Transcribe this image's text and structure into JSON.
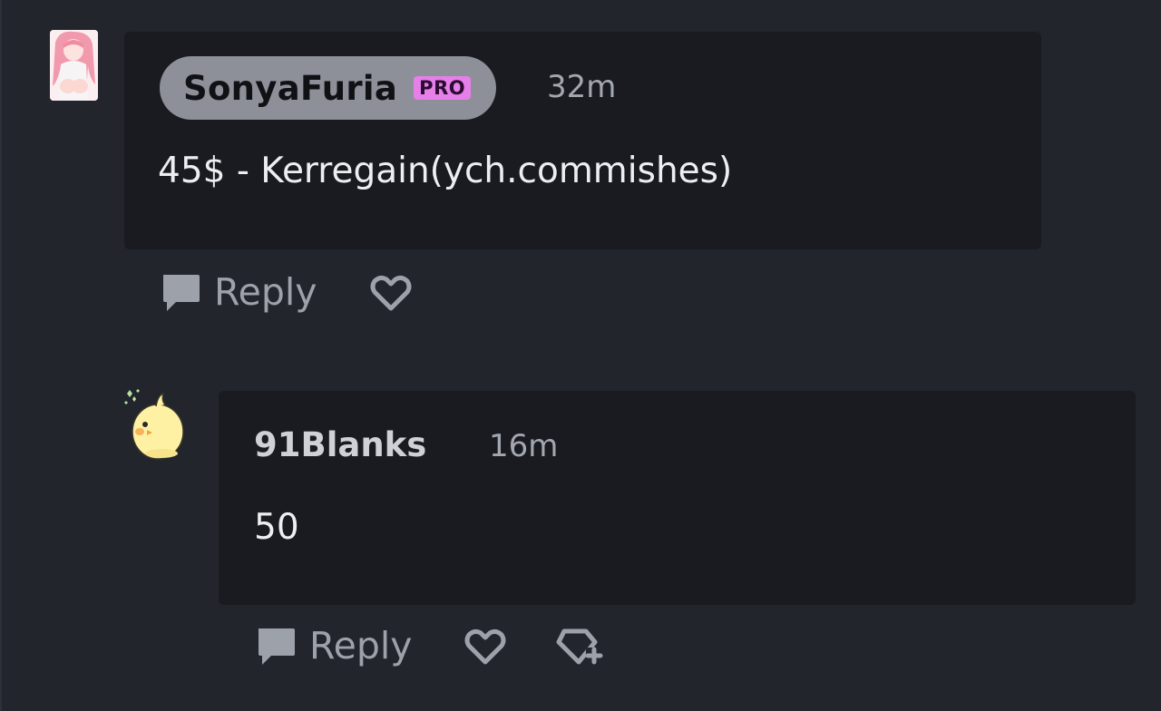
{
  "colors": {
    "page_background": "#22252b",
    "comment_background": "#191b20",
    "name_pill": "#8e9099",
    "pro_badge": "#e77fe8",
    "muted_text": "#9da1aa",
    "body_text": "#eceef2"
  },
  "comments": [
    {
      "username": "SonyaFuria",
      "badge": "PRO",
      "time": "32m",
      "body": "45$ - Kerregain(ych.commishes)",
      "actions": {
        "reply_label": "Reply",
        "icons": [
          "reply-bubble-icon",
          "heart-icon"
        ]
      }
    },
    {
      "username": "91Blanks",
      "time": "16m",
      "body": "50",
      "actions": {
        "reply_label": "Reply",
        "icons": [
          "reply-bubble-icon",
          "heart-icon",
          "gem-plus-icon"
        ]
      }
    }
  ]
}
